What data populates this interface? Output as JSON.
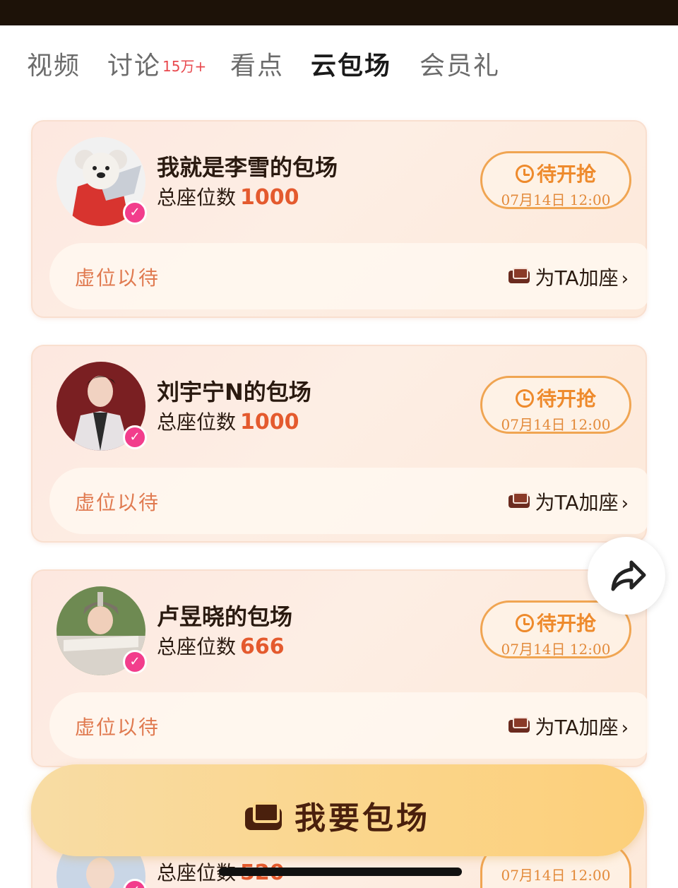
{
  "tabs": [
    {
      "label": "视频",
      "count": ""
    },
    {
      "label": "讨论",
      "count": "15万+"
    },
    {
      "label": "看点",
      "count": ""
    },
    {
      "label": "云包场",
      "count": ""
    },
    {
      "label": "会员礼",
      "count": ""
    }
  ],
  "active_tab": "云包场",
  "cards": [
    {
      "title": "我就是李雪的包场",
      "seats_label": "总座位数",
      "seats": "1000",
      "status": "待开抢",
      "time": "07月14日 12:00",
      "vacant": "虚位以待",
      "add_seat": "为TA加座"
    },
    {
      "title": "刘宇宁N的包场",
      "seats_label": "总座位数",
      "seats": "1000",
      "status": "待开抢",
      "time": "07月14日 12:00",
      "vacant": "虚位以待",
      "add_seat": "为TA加座"
    },
    {
      "title": "卢昱晓的包场",
      "seats_label": "总座位数",
      "seats": "666",
      "status": "待开抢",
      "time": "07月14日 12:00",
      "vacant": "虚位以待",
      "add_seat": "为TA加座"
    },
    {
      "title": "",
      "seats_label": "总座位数",
      "seats": "520",
      "status": "",
      "time": "07月14日 12:00",
      "vacant": "",
      "add_seat": ""
    }
  ],
  "cta": {
    "label": "我要包场"
  },
  "icons": {
    "share": "share-arrow-icon",
    "sofa": "sofa-icon",
    "clock": "clock-icon",
    "verified": "verified-check-icon"
  },
  "colors": {
    "accent_orange": "#ee8a2c",
    "seat_number": "#e45a2e",
    "verified_pink": "#f23d8c",
    "cta_gold": "#fbd58a"
  }
}
